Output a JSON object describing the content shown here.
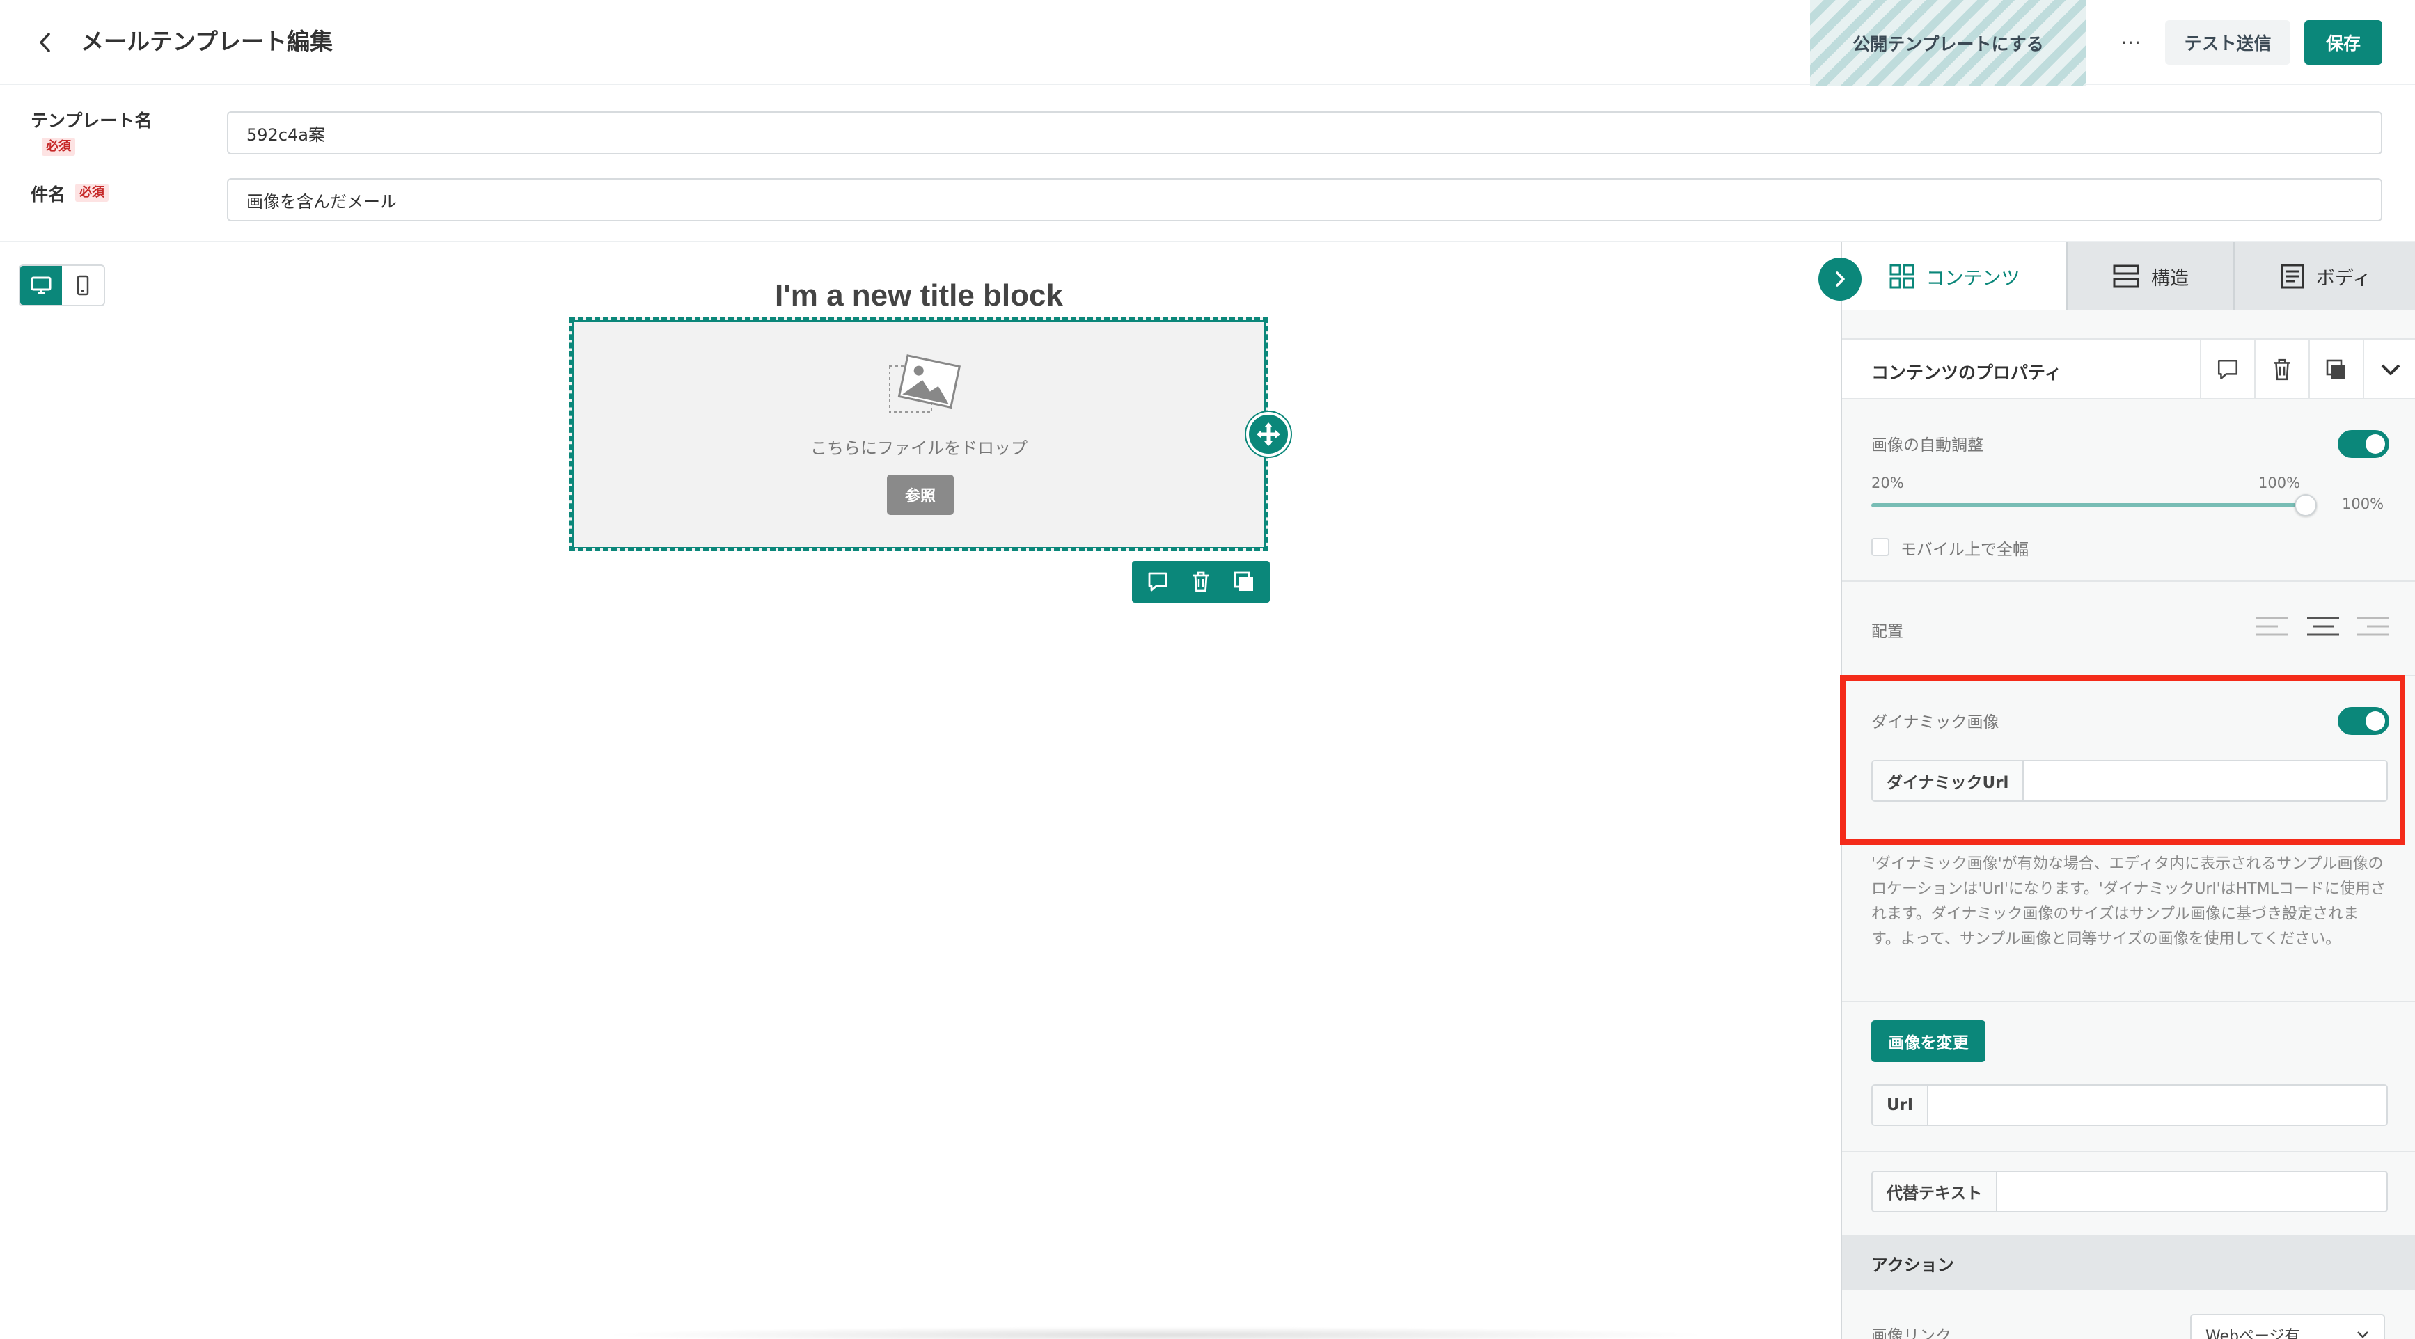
{
  "header": {
    "title": "メールテンプレート編集",
    "publish_label": "公開テンプレートにする",
    "more_label": "···",
    "test_send_label": "テスト送信",
    "save_label": "保存"
  },
  "form": {
    "template_name_label": "テンプレート名",
    "subject_label": "件名",
    "required_badge": "必須",
    "template_name_value": "592c4a案",
    "subject_value": "画像を含んだメール"
  },
  "canvas": {
    "block_title": "I'm a new title block",
    "drop_text": "こちらにファイルをドロップ",
    "browse_label": "参照"
  },
  "panel": {
    "tabs": [
      {
        "label": "コンテンツ",
        "active": true
      },
      {
        "label": "構造",
        "active": false
      },
      {
        "label": "ボディ",
        "active": false
      }
    ],
    "props_title": "コンテンツのプロパティ",
    "auto_resize_label": "画像の自動調整",
    "auto_resize_on": true,
    "slider": {
      "min_label": "20%",
      "max_label": "100%",
      "value_label": "100%",
      "value": 100
    },
    "mobile_full_width_label": "モバイル上で全幅",
    "mobile_full_width_checked": false,
    "alignment_label": "配置",
    "alignment_selected": "center",
    "dynamic_image_label": "ダイナミック画像",
    "dynamic_image_on": true,
    "dynamic_url_label": "ダイナミックUrl",
    "dynamic_url_value": "",
    "help_text": "'ダイナミック画像'が有効な場合、エディタ内に表示されるサンプル画像のロケーションは'Url'になります。'ダイナミックUrl'はHTMLコードに使用されます。ダイナミック画像のサイズはサンプル画像に基づき設定されます。よって、サンプル画像と同等サイズの画像を使用してください。",
    "change_image_label": "画像を変更",
    "url_label": "Url",
    "url_value": "",
    "alt_text_label": "代替テキスト",
    "alt_text_value": "",
    "action_section_label": "アクション",
    "image_link_label": "画像リンク",
    "image_link_value": "Webページ有"
  },
  "colors": {
    "accent": "#0b877a",
    "highlight": "#f42b1a",
    "required": "#c62828"
  }
}
